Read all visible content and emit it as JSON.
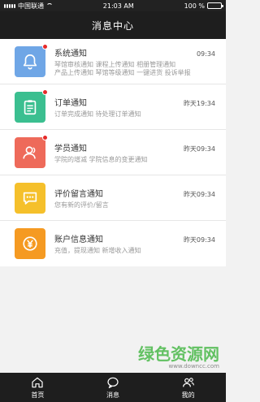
{
  "status_bar": {
    "carrier": "中国联通",
    "time": "21:03 AM",
    "battery": "100 %"
  },
  "header": {
    "title": "消息中心"
  },
  "notifications": [
    {
      "title": "系统通知",
      "time": "09:34",
      "desc": "琴馆审核通知 课程上传通知 相册管理通知",
      "desc2": "产品上传通知 琴馆等级通知 一键进货 投诉举报",
      "color": "#6fa6e6",
      "icon": "bell-icon",
      "unread": true
    },
    {
      "title": "订单通知",
      "time": "昨天19:34",
      "desc": "订单完成通知 待处理订单通知",
      "desc2": "",
      "color": "#3bbf90",
      "icon": "clipboard-icon",
      "unread": true
    },
    {
      "title": "学员通知",
      "time": "昨天09:34",
      "desc": "学院的增减 学院信息的变更通知",
      "desc2": "",
      "color": "#ee6a5a",
      "icon": "users-icon",
      "unread": true
    },
    {
      "title": "评价留言通知",
      "time": "昨天09:34",
      "desc": "您有新的评价/留言",
      "desc2": "",
      "color": "#f5c02b",
      "icon": "chat-icon",
      "unread": false
    },
    {
      "title": "账户信息通知",
      "time": "昨天09:34",
      "desc": "充值，提现通知 新增收入通知",
      "desc2": "",
      "color": "#f59a22",
      "icon": "yen-icon",
      "unread": false
    }
  ],
  "tab_bar": {
    "home": "首页",
    "messages": "消息",
    "mine": "我的"
  },
  "watermark": {
    "text": "绿色资源网",
    "url": "www.downcc.com"
  }
}
